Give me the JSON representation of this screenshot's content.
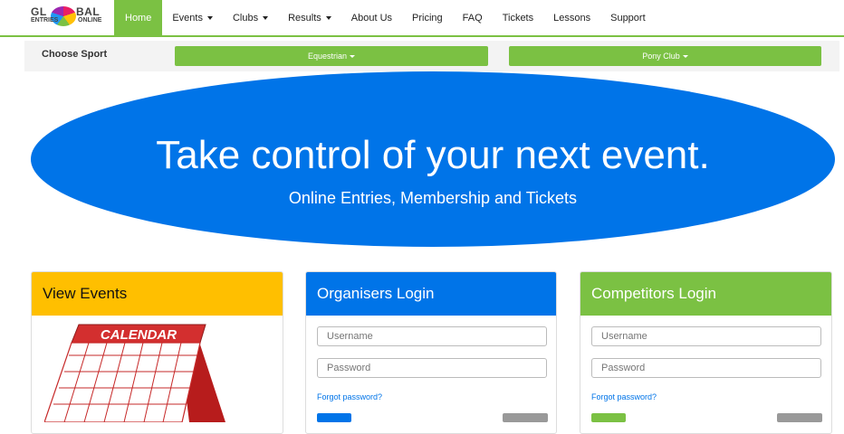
{
  "brand": {
    "logo_top_left": "GL",
    "logo_top_right": "BAL",
    "logo_bottom_left": "ENTRIES",
    "logo_bottom_right": "ONLINE"
  },
  "nav": {
    "items": [
      {
        "label": "Home",
        "active": true,
        "dropdown": false
      },
      {
        "label": "Events",
        "dropdown": true
      },
      {
        "label": "Clubs",
        "dropdown": true
      },
      {
        "label": "Results",
        "dropdown": true
      },
      {
        "label": "About Us",
        "dropdown": false
      },
      {
        "label": "Pricing",
        "dropdown": false
      },
      {
        "label": "FAQ",
        "dropdown": false
      },
      {
        "label": "Tickets",
        "dropdown": false
      },
      {
        "label": "Lessons",
        "dropdown": false
      },
      {
        "label": "Support",
        "dropdown": false
      }
    ]
  },
  "sport": {
    "label": "Choose Sport",
    "options": [
      {
        "label": "Equestrian"
      },
      {
        "label": "Pony Club"
      }
    ]
  },
  "hero": {
    "title": "Take control of your next event.",
    "subtitle": "Online Entries, Membership and Tickets"
  },
  "panels": {
    "events": {
      "title": "View Events",
      "calendar_text": "CALENDAR"
    },
    "organisers": {
      "title": "Organisers Login",
      "username_placeholder": "Username",
      "password_placeholder": "Password",
      "forgot": "Forgot password?"
    },
    "competitors": {
      "title": "Competitors Login",
      "username_placeholder": "Username",
      "password_placeholder": "Password",
      "forgot": "Forgot password?"
    }
  },
  "colors": {
    "brand_green": "#7bc143",
    "brand_blue": "#0074e8",
    "brand_yellow": "#ffbf00",
    "calendar_red": "#d32f2f"
  }
}
